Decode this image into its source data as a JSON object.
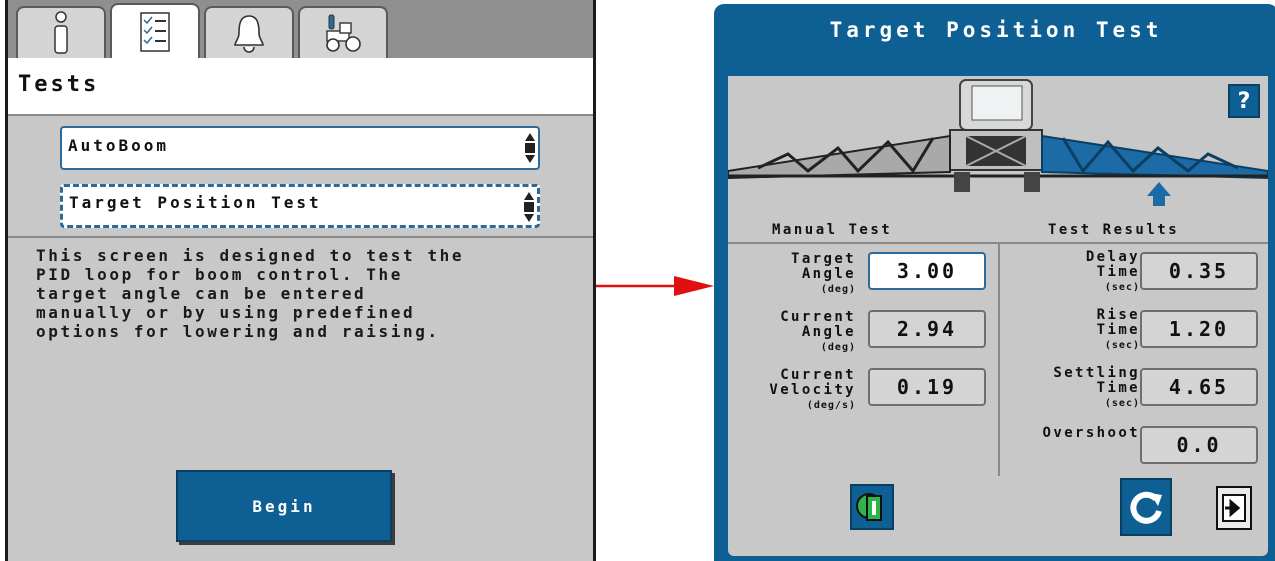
{
  "left_screen": {
    "tabs": [
      {
        "icon": "info-icon",
        "active": false
      },
      {
        "icon": "checklist-icon",
        "active": true
      },
      {
        "icon": "alarm-bell-icon",
        "active": false
      },
      {
        "icon": "tractor-tools-icon",
        "active": false
      }
    ],
    "title": "Tests",
    "module_select": {
      "value": "AutoBoom"
    },
    "test_select": {
      "value": "Target Position Test"
    },
    "description": "This screen is designed to test the\nPID loop for boom control. The\ntarget angle can be entered\nmanually or by using predefined\noptions for lowering and raising.",
    "begin_label": "Begin"
  },
  "arrow": {
    "color": "#e01010"
  },
  "right_screen": {
    "title": "Target Position Test",
    "help_label": "?",
    "manual_test_header": "Manual Test",
    "test_results_header": "Test Results",
    "manual": {
      "target_angle": {
        "label_1": "Target",
        "label_2": "Angle",
        "unit": "(deg)",
        "value": "3.00"
      },
      "current_angle": {
        "label_1": "Current",
        "label_2": "Angle",
        "unit": "(deg)",
        "value": "2.94"
      },
      "current_velocity": {
        "label_1": "Current",
        "label_2": "Velocity",
        "unit": "(deg/s)",
        "value": "0.19"
      }
    },
    "results": {
      "delay_time": {
        "label_1": "Delay",
        "label_2": "Time",
        "unit": "(sec)",
        "value": "0.35"
      },
      "rise_time": {
        "label_1": "Rise",
        "label_2": "Time",
        "unit": "(sec)",
        "value": "1.20"
      },
      "settling_time": {
        "label_1": "Settling",
        "label_2": "Time",
        "unit": "(sec)",
        "value": "4.65"
      },
      "overshoot": {
        "label_1": "Overshoot",
        "value": "0.0"
      }
    },
    "bottom_icons": [
      "manual-mode-icon",
      "restart-icon",
      "exit-icon"
    ],
    "colors": {
      "accent": "#0e5f93",
      "boom_highlight": "#1c6aa6"
    }
  }
}
